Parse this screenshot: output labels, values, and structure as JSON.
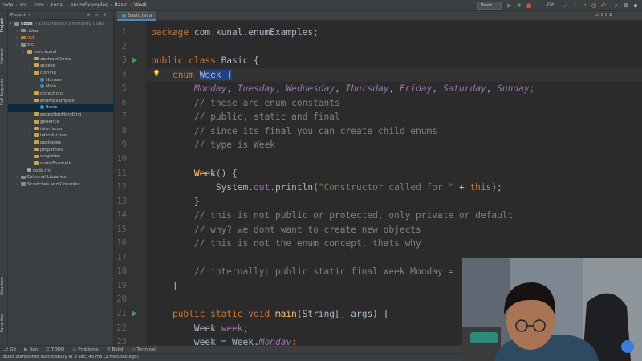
{
  "breadcrumbs": [
    "code",
    "src",
    "com",
    "kunal",
    "enumExamples",
    "Basic",
    "Week"
  ],
  "run_config": "Basic",
  "git_label": "Git:",
  "left_strip": [
    "Project",
    "Commit",
    "Pull Requests",
    "Structure",
    "Favorites"
  ],
  "project_panel": {
    "title": "Project",
    "root_label": "code",
    "root_path": "~/Documents/Community Class",
    "items": [
      {
        "label": ".idea",
        "depth": 1,
        "type": "folder"
      },
      {
        "label": "out",
        "depth": 1,
        "type": "folder-orange"
      },
      {
        "label": "src",
        "depth": 1,
        "type": "folder"
      },
      {
        "label": "com.kunal",
        "depth": 2,
        "type": "pkg"
      },
      {
        "label": "abstractDemo",
        "depth": 3,
        "type": "pkg"
      },
      {
        "label": "access",
        "depth": 3,
        "type": "pkg"
      },
      {
        "label": "cloning",
        "depth": 3,
        "type": "pkg"
      },
      {
        "label": "Human",
        "depth": 4,
        "type": "class"
      },
      {
        "label": "Main",
        "depth": 4,
        "type": "class"
      },
      {
        "label": "collections",
        "depth": 3,
        "type": "pkg"
      },
      {
        "label": "enumExamples",
        "depth": 3,
        "type": "pkg"
      },
      {
        "label": "Basic",
        "depth": 4,
        "type": "class",
        "selected": true
      },
      {
        "label": "exceptionHandling",
        "depth": 3,
        "type": "pkg"
      },
      {
        "label": "generics",
        "depth": 3,
        "type": "pkg"
      },
      {
        "label": "interfaces",
        "depth": 3,
        "type": "pkg"
      },
      {
        "label": "introduction",
        "depth": 3,
        "type": "pkg"
      },
      {
        "label": "packages",
        "depth": 3,
        "type": "pkg"
      },
      {
        "label": "properties",
        "depth": 3,
        "type": "pkg"
      },
      {
        "label": "singleton",
        "depth": 3,
        "type": "pkg"
      },
      {
        "label": "staticExample",
        "depth": 3,
        "type": "pkg"
      },
      {
        "label": "code.iml",
        "depth": 2,
        "type": "file"
      },
      {
        "label": "External Libraries",
        "depth": 1,
        "type": "lib"
      },
      {
        "label": "Scratches and Consoles",
        "depth": 1,
        "type": "lib"
      }
    ]
  },
  "editor_tab": "Basic.java",
  "inspection": "8  6  2",
  "code_lines": [
    {
      "n": "1",
      "segs": [
        [
          "kw",
          "package "
        ],
        [
          "pl",
          "com.kunal.enumExamples;"
        ]
      ]
    },
    {
      "n": "2",
      "segs": []
    },
    {
      "n": "3",
      "segs": [
        [
          "kw",
          "public class "
        ],
        [
          "pl",
          "Basic {"
        ]
      ],
      "run": true
    },
    {
      "n": "4",
      "segs": [
        [
          "pl",
          "    "
        ],
        [
          "kw",
          "enum "
        ],
        [
          "sel",
          "Week {"
        ]
      ],
      "caret": true
    },
    {
      "n": "5",
      "segs": [
        [
          "pl",
          "        "
        ],
        [
          "en",
          "Monday"
        ],
        [
          "pl",
          ", "
        ],
        [
          "en",
          "Tuesday"
        ],
        [
          "pl",
          ", "
        ],
        [
          "en",
          "Wednesday"
        ],
        [
          "pl",
          ", "
        ],
        [
          "en",
          "Thursday"
        ],
        [
          "pl",
          ", "
        ],
        [
          "en",
          "Friday"
        ],
        [
          "pl",
          ", "
        ],
        [
          "en",
          "Saturday"
        ],
        [
          "pl",
          ", "
        ],
        [
          "en",
          "Sunday"
        ],
        [
          "kw",
          ";"
        ]
      ]
    },
    {
      "n": "6",
      "segs": [
        [
          "cm",
          "        // these are enum constants"
        ]
      ]
    },
    {
      "n": "7",
      "segs": [
        [
          "cm",
          "        // public, static and final"
        ]
      ]
    },
    {
      "n": "8",
      "segs": [
        [
          "cm",
          "        // since its final you can create child enums"
        ]
      ]
    },
    {
      "n": "9",
      "segs": [
        [
          "cm",
          "        // type is Week"
        ]
      ]
    },
    {
      "n": "10",
      "segs": []
    },
    {
      "n": "11",
      "segs": [
        [
          "pl",
          "        "
        ],
        [
          "fn",
          "Week"
        ],
        [
          "pl",
          "() {"
        ]
      ]
    },
    {
      "n": "12",
      "segs": [
        [
          "pl",
          "            System."
        ],
        [
          "fld",
          "out"
        ],
        [
          "pl",
          ".println("
        ],
        [
          "st",
          "\"Constructor called for \""
        ],
        [
          "pl",
          " + "
        ],
        [
          "kw",
          "this"
        ],
        [
          "pl",
          ");"
        ]
      ]
    },
    {
      "n": "13",
      "segs": [
        [
          "pl",
          "        }"
        ]
      ]
    },
    {
      "n": "14",
      "segs": [
        [
          "cm",
          "        // this is not public or protected, only private or default"
        ]
      ]
    },
    {
      "n": "15",
      "segs": [
        [
          "cm",
          "        // why? we dont want to create new objects"
        ]
      ]
    },
    {
      "n": "16",
      "segs": [
        [
          "cm",
          "        // this is not the enum concept, thats why"
        ]
      ]
    },
    {
      "n": "17",
      "segs": []
    },
    {
      "n": "18",
      "segs": [
        [
          "cm",
          "        // internally: public static final Week Monday = "
        ]
      ]
    },
    {
      "n": "19",
      "segs": [
        [
          "pl",
          "    }"
        ]
      ]
    },
    {
      "n": "20",
      "segs": []
    },
    {
      "n": "21",
      "segs": [
        [
          "pl",
          "    "
        ],
        [
          "kw",
          "public static void "
        ],
        [
          "fn",
          "main"
        ],
        [
          "pl",
          "(String[] args) {"
        ]
      ],
      "run": true
    },
    {
      "n": "22",
      "segs": [
        [
          "pl",
          "        Week "
        ],
        [
          "fld",
          "week"
        ],
        [
          "kw",
          ";"
        ]
      ]
    },
    {
      "n": "23",
      "segs": [
        [
          "pl",
          "        week = Week."
        ],
        [
          "en",
          "Monday"
        ],
        [
          "kw",
          ";"
        ]
      ]
    }
  ],
  "bottom_tools": [
    "Git",
    "Run",
    "TODO",
    "Problems",
    "Build",
    "Terminal"
  ],
  "status": "Build completed successfully in 3 sec, 45 ms (2 minutes ago)"
}
